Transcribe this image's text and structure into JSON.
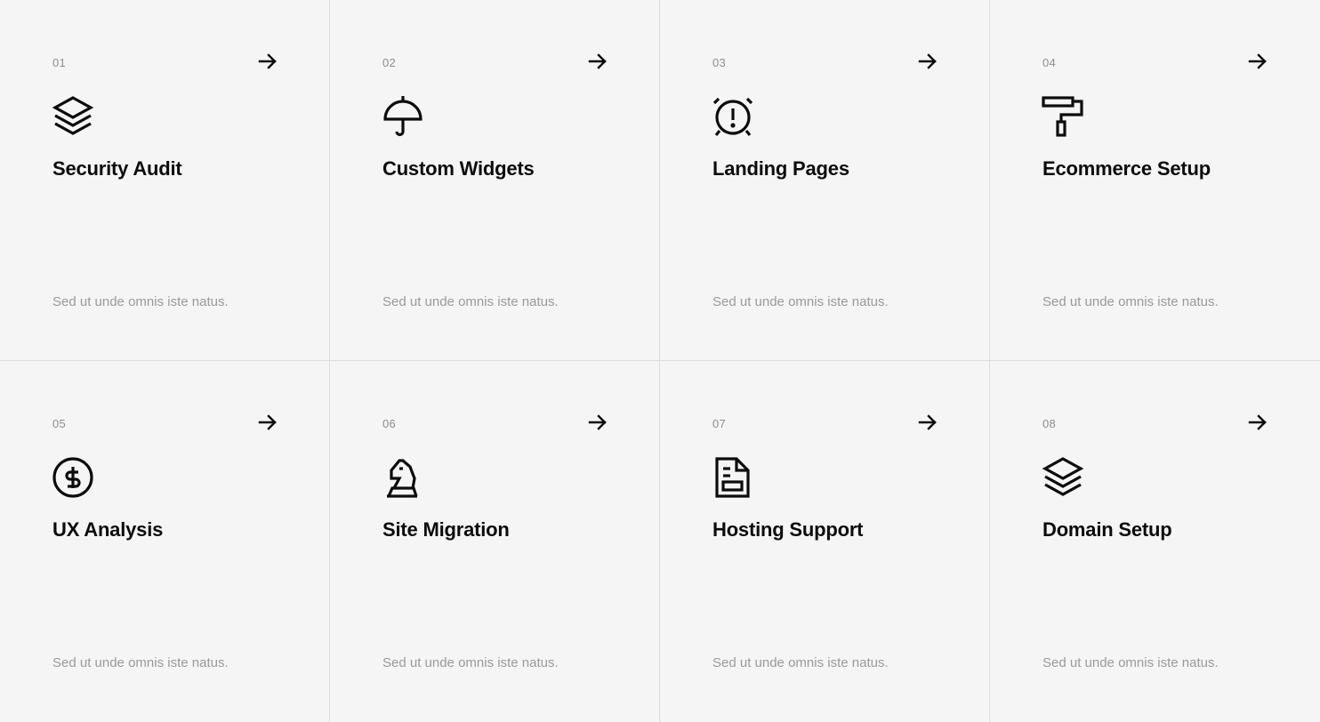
{
  "services": [
    {
      "number": "01",
      "title": "Security Audit",
      "description": "Sed ut unde omnis iste natus.",
      "icon": "layers-icon"
    },
    {
      "number": "02",
      "title": "Custom Widgets",
      "description": "Sed ut unde omnis iste natus.",
      "icon": "umbrella-icon"
    },
    {
      "number": "03",
      "title": "Landing Pages",
      "description": "Sed ut unde omnis iste natus.",
      "icon": "alarm-clock-icon"
    },
    {
      "number": "04",
      "title": "Ecommerce Setup",
      "description": "Sed ut unde omnis iste natus.",
      "icon": "paint-roller-icon"
    },
    {
      "number": "05",
      "title": "UX Analysis",
      "description": "Sed ut unde omnis iste natus.",
      "icon": "dollar-coin-icon"
    },
    {
      "number": "06",
      "title": "Site Migration",
      "description": "Sed ut unde omnis iste natus.",
      "icon": "chess-knight-icon"
    },
    {
      "number": "07",
      "title": "Hosting Support",
      "description": "Sed ut unde omnis iste natus.",
      "icon": "document-icon"
    },
    {
      "number": "08",
      "title": "Domain Setup",
      "description": "Sed ut unde omnis iste natus.",
      "icon": "layers-icon"
    }
  ],
  "colors": {
    "background": "#f5f5f5",
    "divider": "#dcdcdc",
    "text": "#0c0c0c",
    "muted": "#9a9a9a"
  }
}
